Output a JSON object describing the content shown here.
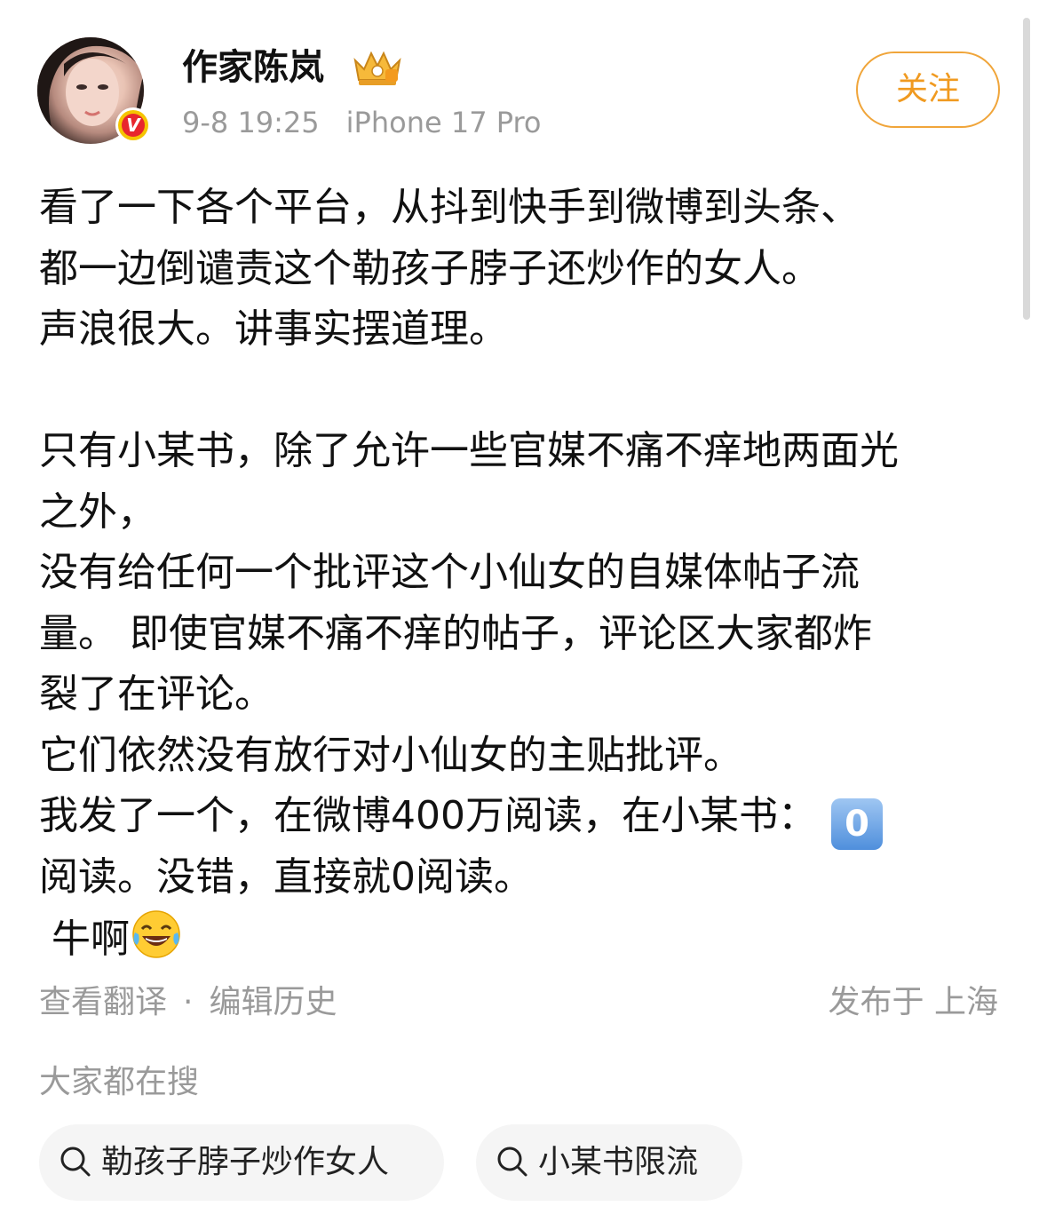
{
  "author": {
    "name": "作家陈岚",
    "verified_badge": "V",
    "badge_icon": "crown-badge-icon"
  },
  "meta": {
    "time": "9-8 19:25",
    "device": "iPhone 17 Pro"
  },
  "follow_button": {
    "label": "关注"
  },
  "post": {
    "lines": [
      "看了一下各个平台，从抖到快手到微博到头条、",
      "都一边倒谴责这个勒孩子脖子还炒作的女人。",
      "声浪很大。讲事实摆道理。",
      "",
      "只有小某书，除了允许一些官媒不痛不痒地两面光",
      "之外，",
      "没有给任何一个批评这个小仙女的自媒体帖子流",
      "量。 即使官媒不痛不痒的帖子，评论区大家都炸",
      "裂了在评论。",
      "它们依然没有放行对小仙女的主贴批评。",
      "我发了一个，在微博400万阅读，在小某书：",
      "阅读。没错，直接就0阅读。",
      " 牛啊"
    ],
    "keycap_digit": "0",
    "emoji": "laughing-tears-emoji"
  },
  "footer": {
    "translate": "查看翻译",
    "separator": "·",
    "edit_history": "编辑历史",
    "location": "发布于 上海"
  },
  "search": {
    "title": "大家都在搜",
    "chips": [
      "勒孩子脖子炒作女人",
      "小某书限流"
    ]
  },
  "colors": {
    "follow_accent": "#f09a20",
    "muted_text": "#9a9a9a",
    "chip_bg": "#f5f5f5",
    "verified_red": "#e8262d",
    "verified_gold": "#f5c400"
  }
}
